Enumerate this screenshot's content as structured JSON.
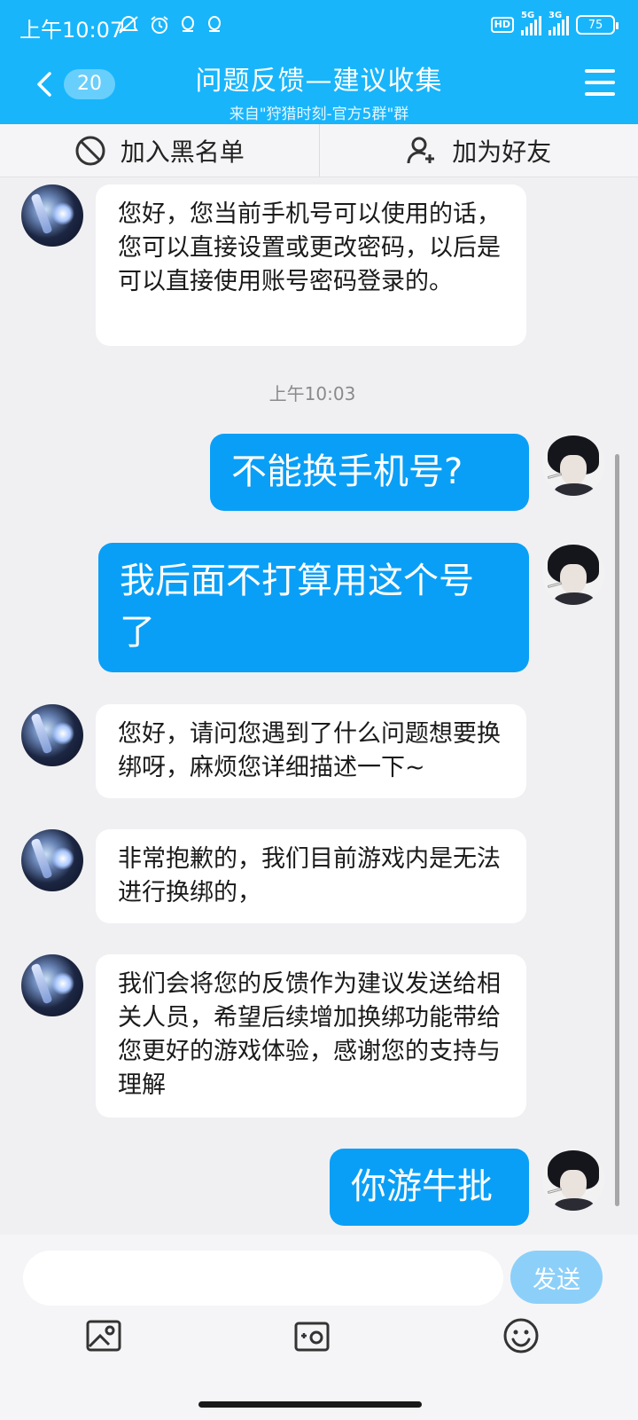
{
  "status_bar": {
    "time": "上午10:07",
    "network_1": "5G",
    "network_2": "3G",
    "hd_badge": "HD",
    "battery": "75",
    "icons": [
      "mute-alarm-icon",
      "alarm-icon",
      "app-notification-icon",
      "app-notification-icon",
      "hd-voice-icon",
      "signal-icon",
      "battery-icon"
    ]
  },
  "header": {
    "unread_count": "20",
    "title": "问题反馈—建议收集",
    "subtitle": "来自\"狩猎时刻-官方5群\"群",
    "background_color": "#18b5fb"
  },
  "actions": {
    "block_label": "加入黑名单",
    "add_friend_label": "加为好友"
  },
  "messages": [
    {
      "sender": "them",
      "text": "您好，您当前手机号可以使用的话，您可以直接设置或更改密码，以后是可以直接使用账号密码登录的。"
    },
    {
      "sender": "me",
      "text": "不能换手机号?"
    },
    {
      "sender": "me",
      "text": "我后面不打算用这个号了"
    },
    {
      "sender": "them",
      "text": "您好，请问您遇到了什么问题想要换绑呀，麻烦您详细描述一下~"
    },
    {
      "sender": "them",
      "text": "非常抱歉的，我们目前游戏内是无法进行换绑的，"
    },
    {
      "sender": "them",
      "text": "我们会将您的反馈作为建议发送给相关人员，希望后续增加换绑功能带给您更好的游戏体验，感谢您的支持与理解"
    },
    {
      "sender": "me",
      "text": "你游牛批"
    }
  ],
  "timestamp": "上午10:03",
  "input": {
    "placeholder": "",
    "value": "",
    "send_label": "发送"
  },
  "colors": {
    "my_bubble": "#0a9ff6",
    "their_bubble": "#ffffff",
    "chat_background": "#f0f0f3",
    "send_button": "#8cd0fa"
  }
}
